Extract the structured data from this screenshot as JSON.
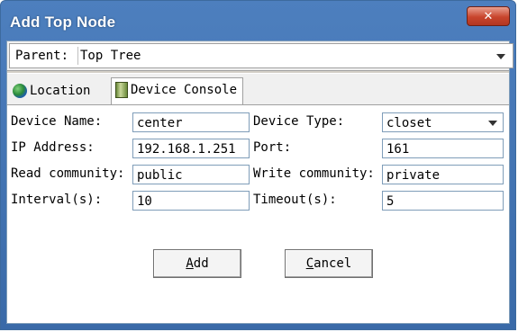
{
  "window": {
    "title": "Add Top Node",
    "close_glyph": "✕"
  },
  "parent": {
    "label": "Parent:",
    "value": "Top Tree"
  },
  "tabs": [
    {
      "label": "Location",
      "icon": "globe-icon"
    },
    {
      "label": "Device Console",
      "icon": "cabinet-icon",
      "active": true
    }
  ],
  "form": {
    "device_name": {
      "label": "Device Name:",
      "value": "center"
    },
    "device_type": {
      "label": "Device Type:",
      "value": "closet"
    },
    "ip_address": {
      "label": "IP Address:",
      "value": "192.168.1.251"
    },
    "port": {
      "label": "Port:",
      "value": "161"
    },
    "read_community": {
      "label": "Read community:",
      "value": "public"
    },
    "write_community": {
      "label": "Write community:",
      "value": "private"
    },
    "interval": {
      "label": "Interval(s):",
      "value": "10"
    },
    "timeout": {
      "label": "Timeout(s):",
      "value": "5"
    }
  },
  "buttons": {
    "add": {
      "mnemonic": "A",
      "rest": "dd"
    },
    "cancel": {
      "mnemonic": "C",
      "rest": "ancel"
    }
  }
}
